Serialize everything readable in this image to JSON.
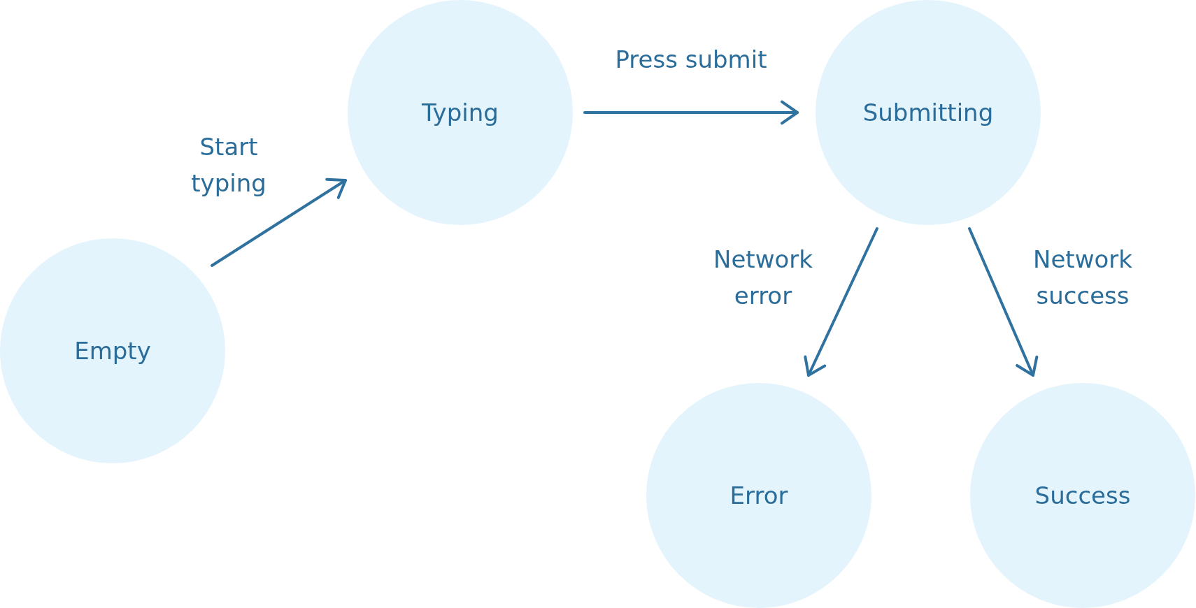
{
  "states": [
    {
      "label": "Empty"
    },
    {
      "label": "Typing"
    },
    {
      "label": "Submitting"
    },
    {
      "label": "Error"
    },
    {
      "label": "Success"
    }
  ],
  "transitions": [
    {
      "label": "Start typing"
    },
    {
      "label": "Press submit"
    },
    {
      "label": "Network error"
    },
    {
      "label": "Network success"
    }
  ]
}
